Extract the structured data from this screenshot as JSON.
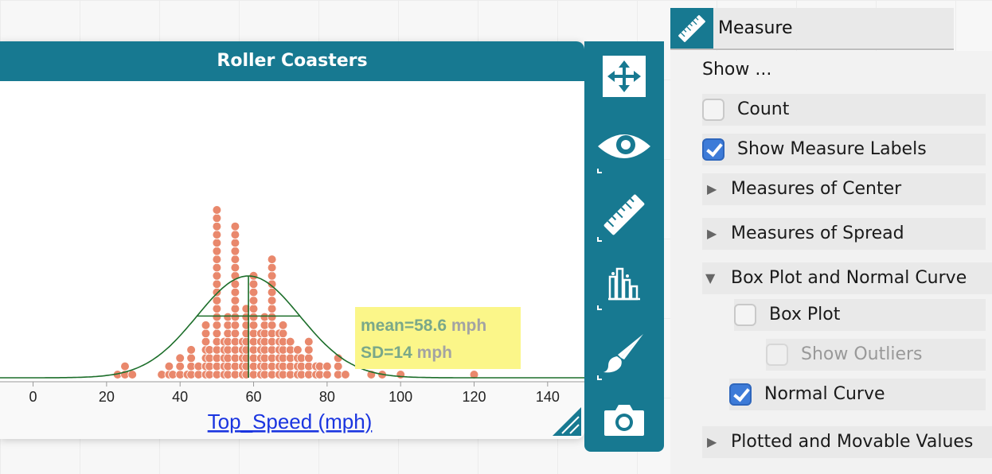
{
  "graph": {
    "title": "Roller Coasters",
    "x_attribute_label": "Top_Speed (mph)",
    "measure_label": {
      "mean_prefix": "mean=58.6",
      "sd_prefix": "SD=14",
      "unit": "mph"
    }
  },
  "chart_data": {
    "type": "scatter",
    "subtype": "dot-plot",
    "xlabel": "Top_Speed (mph)",
    "xlim": [
      -9,
      150
    ],
    "x_ticks": [
      0,
      20,
      40,
      60,
      80,
      100,
      120,
      140
    ],
    "x_tick_labels": [
      "0",
      "20",
      "40",
      "60",
      "80",
      "100",
      "120",
      "140"
    ],
    "mean": 58.6,
    "sd": 14,
    "stacks": [
      {
        "x": 23,
        "count": 1
      },
      {
        "x": 25,
        "count": 2
      },
      {
        "x": 27,
        "count": 1
      },
      {
        "x": 35,
        "count": 1
      },
      {
        "x": 37,
        "count": 2
      },
      {
        "x": 38,
        "count": 1
      },
      {
        "x": 40,
        "count": 3
      },
      {
        "x": 42,
        "count": 1
      },
      {
        "x": 43,
        "count": 4
      },
      {
        "x": 45,
        "count": 2
      },
      {
        "x": 47,
        "count": 7
      },
      {
        "x": 48,
        "count": 4
      },
      {
        "x": 50,
        "count": 21
      },
      {
        "x": 52,
        "count": 5
      },
      {
        "x": 53,
        "count": 8
      },
      {
        "x": 55,
        "count": 19
      },
      {
        "x": 57,
        "count": 5
      },
      {
        "x": 58,
        "count": 9
      },
      {
        "x": 60,
        "count": 13
      },
      {
        "x": 62,
        "count": 6
      },
      {
        "x": 63,
        "count": 8
      },
      {
        "x": 65,
        "count": 15
      },
      {
        "x": 67,
        "count": 6
      },
      {
        "x": 68,
        "count": 7
      },
      {
        "x": 70,
        "count": 5
      },
      {
        "x": 72,
        "count": 4
      },
      {
        "x": 73,
        "count": 3
      },
      {
        "x": 75,
        "count": 5
      },
      {
        "x": 77,
        "count": 2
      },
      {
        "x": 78,
        "count": 2
      },
      {
        "x": 80,
        "count": 2
      },
      {
        "x": 83,
        "count": 3
      },
      {
        "x": 85,
        "count": 1
      },
      {
        "x": 92,
        "count": 1
      },
      {
        "x": 95,
        "count": 1
      },
      {
        "x": 100,
        "count": 1
      },
      {
        "x": 120,
        "count": 1
      }
    ],
    "colors": {
      "dot": "#e9886c",
      "curve": "#1c6e2a",
      "label_bg": "#fbf689",
      "label_value": "#7aa889",
      "label_unit": "#a3a3a3"
    }
  },
  "toolbar": {
    "tools": [
      {
        "icon": "move-arrows-icon",
        "name": "move"
      },
      {
        "icon": "eye-icon",
        "name": "hide-show"
      },
      {
        "icon": "ruler-icon",
        "name": "measure"
      },
      {
        "icon": "bar-chart-icon",
        "name": "display-config"
      },
      {
        "icon": "paintbrush-icon",
        "name": "format"
      },
      {
        "icon": "camera-icon",
        "name": "camera"
      }
    ],
    "accent": "#177991"
  },
  "measure_panel": {
    "title": "Measure",
    "show_heading": "Show ...",
    "count": {
      "label": "Count",
      "checked": false
    },
    "show_measure_labels": {
      "label": "Show Measure Labels",
      "checked": true
    },
    "sections": {
      "center": "Measures of Center",
      "spread": "Measures of Spread",
      "box_normal": "Box Plot and Normal Curve",
      "plotted": "Plotted and Movable Values"
    },
    "box_plot": {
      "label": "Box Plot",
      "checked": false
    },
    "show_outliers": {
      "label": "Show Outliers",
      "checked": false,
      "disabled": true
    },
    "normal_curve": {
      "label": "Normal Curve",
      "checked": true
    }
  }
}
